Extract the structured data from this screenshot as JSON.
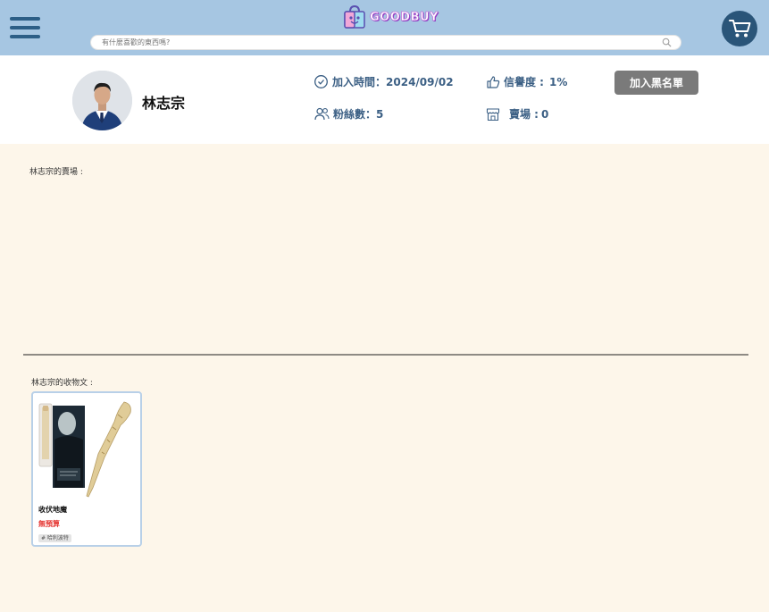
{
  "header": {
    "logo_text": "GOODBUY",
    "search_placeholder": "有什麼喜歡的東西嗎?",
    "icons": {
      "menu": "hamburger-menu-icon",
      "search": "search-icon",
      "cart": "shopping-cart-icon"
    },
    "colors": {
      "bar": "#a6c6e2",
      "cart_bg": "#2a5579",
      "menu": "#2c5e86"
    }
  },
  "profile": {
    "username": "林志宗",
    "join_label": "加入時間：",
    "join_date": "2024/09/02",
    "rating_label": "信譽度 :",
    "rating_value": "1%",
    "fans_label": "粉絲數",
    "fans_sep": "：",
    "fans_value": "5",
    "stores_label": "賣場 :",
    "stores_value": "0",
    "blacklist_button": "加入黑名單",
    "icons": {
      "join": "calendar-check-icon",
      "rating": "thumbs-up-icon",
      "fans": "users-icon",
      "store": "store-icon"
    }
  },
  "stores_section": {
    "title": "林志宗的賣場 :"
  },
  "wants_section": {
    "title": "林志宗的收物文 :",
    "items": [
      {
        "title": "收伏地魔",
        "budget": "無預算",
        "tag": "# 哈利波特"
      }
    ]
  },
  "colors": {
    "page_bg": "#fdf6ea",
    "accent_text": "#3b5f84",
    "budget_red": "#e53935"
  }
}
